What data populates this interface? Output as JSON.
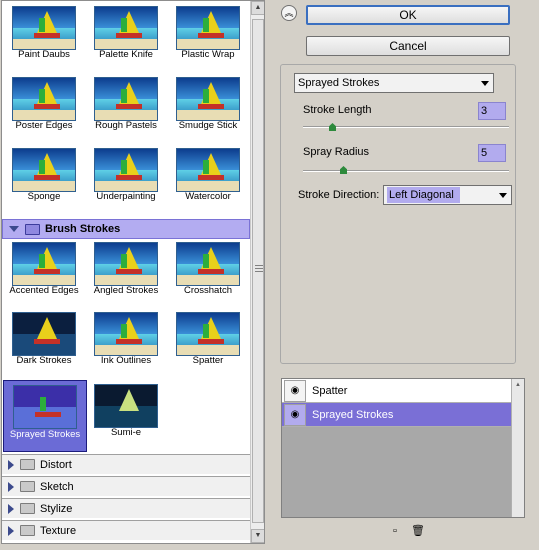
{
  "gallery": {
    "artistic": [
      {
        "label": "Paint Daubs"
      },
      {
        "label": "Palette Knife"
      },
      {
        "label": "Plastic Wrap"
      },
      {
        "label": "Poster Edges"
      },
      {
        "label": "Rough Pastels"
      },
      {
        "label": "Smudge Stick"
      },
      {
        "label": "Sponge"
      },
      {
        "label": "Underpainting"
      },
      {
        "label": "Watercolor"
      }
    ],
    "brush_strokes_label": "Brush Strokes",
    "brush_strokes": [
      {
        "label": "Accented Edges"
      },
      {
        "label": "Angled Strokes"
      },
      {
        "label": "Crosshatch"
      },
      {
        "label": "Dark Strokes"
      },
      {
        "label": "Ink Outlines"
      },
      {
        "label": "Spatter"
      },
      {
        "label": "Sprayed Strokes"
      },
      {
        "label": "Sumi-e"
      }
    ],
    "collapsed_categories": [
      "Distort",
      "Sketch",
      "Stylize",
      "Texture"
    ]
  },
  "buttons": {
    "ok": "OK",
    "cancel": "Cancel",
    "collapse_icon": "double-chevron-up-icon"
  },
  "settings": {
    "filter": "Sprayed Strokes",
    "stroke_length_label": "Stroke Length",
    "stroke_length_value": "3",
    "spray_radius_label": "Spray Radius",
    "spray_radius_value": "5",
    "stroke_direction_label": "Stroke Direction:",
    "stroke_direction_value": "Left Diagonal"
  },
  "layers": [
    {
      "label": "Spatter",
      "active": false
    },
    {
      "label": "Sprayed Strokes",
      "active": true
    }
  ],
  "colors": {
    "selection": "#b2abee",
    "active_layer": "#7a6fd6"
  }
}
